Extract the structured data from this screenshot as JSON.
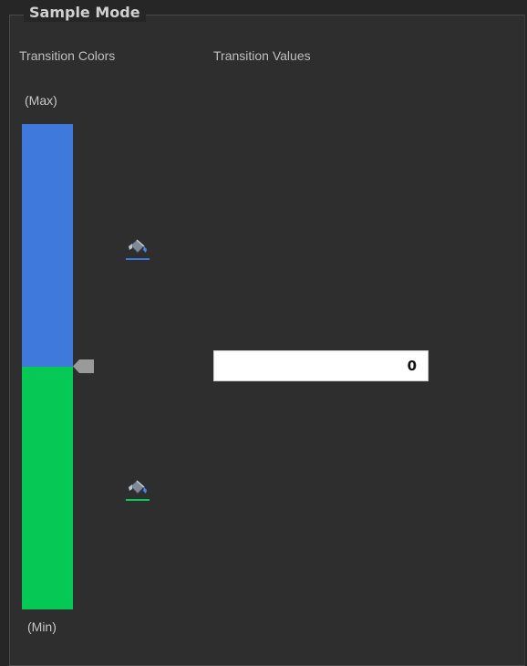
{
  "group": {
    "title": "Sample Mode"
  },
  "headers": {
    "colors": "Transition Colors",
    "values": "Transition Values"
  },
  "scale": {
    "max_label": "(Max)",
    "min_label": "(Min)"
  },
  "color_bar": {
    "segments": [
      {
        "name": "upper",
        "color": "#3f79dc"
      },
      {
        "name": "lower",
        "color": "#06c854"
      }
    ],
    "handle_color": "#9a9a9a"
  },
  "color_pickers": [
    {
      "icon": "paint-bucket-icon",
      "underline_color": "#3f79dc"
    },
    {
      "icon": "paint-bucket-icon",
      "underline_color": "#06c854"
    }
  ],
  "transition_values": [
    {
      "value": "0"
    }
  ]
}
